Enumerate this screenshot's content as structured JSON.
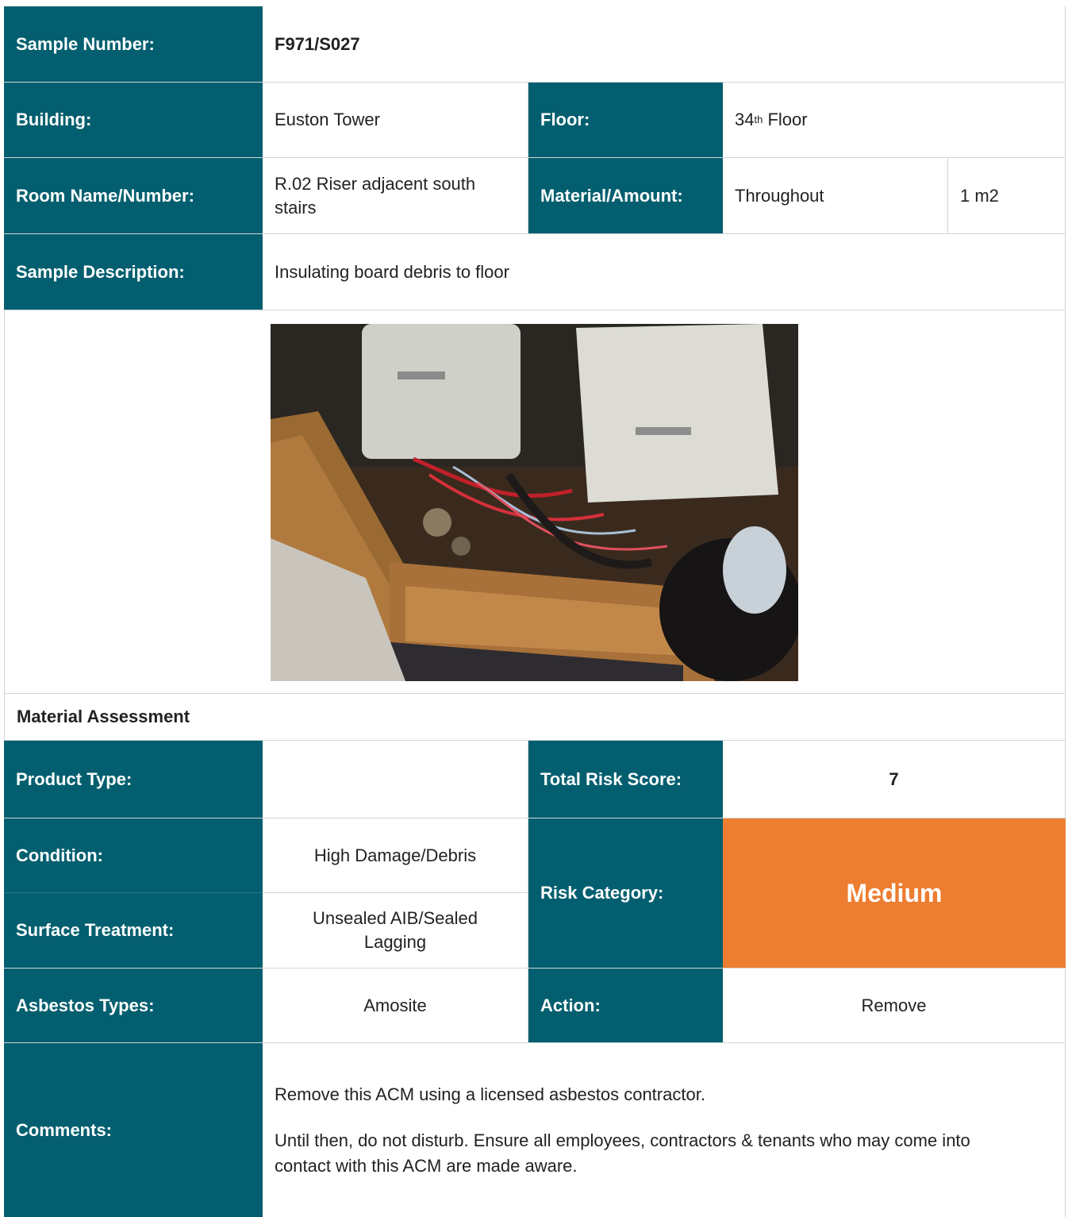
{
  "sample_number": {
    "label": "Sample Number:",
    "value": "F971/S027"
  },
  "building": {
    "label": "Building:",
    "value": "Euston Tower"
  },
  "floor": {
    "label": "Floor:",
    "value_num": "34",
    "value_sup": "th",
    "value_rest": " Floor"
  },
  "room": {
    "label": "Room Name/Number:",
    "value": "R.02 Riser adjacent south stairs"
  },
  "material_amount": {
    "label": "Material/Amount:",
    "material": "Throughout",
    "amount": "1 m2"
  },
  "sample_description": {
    "label": "Sample Description:",
    "value": "Insulating board debris to floor"
  },
  "material_assessment": {
    "heading": "Material Assessment"
  },
  "product_type": {
    "label": "Product Type:",
    "value": ""
  },
  "total_risk_score": {
    "label": "Total Risk Score:",
    "value": "7"
  },
  "condition": {
    "label": "Condition:",
    "value": "High Damage/Debris"
  },
  "surface_treatment": {
    "label": "Surface Treatment:",
    "value": "Unsealed AIB/Sealed Lagging"
  },
  "risk_category": {
    "label": "Risk Category:",
    "value": "Medium",
    "color": "#ed7d31"
  },
  "asbestos_types": {
    "label": "Asbestos Types:",
    "value": "Amosite"
  },
  "action": {
    "label": "Action:",
    "value": "Remove"
  },
  "comments": {
    "label": "Comments:",
    "line1": "Remove this ACM using a licensed asbestos contractor.",
    "line2": "Until then, do not disturb. Ensure all employees, contractors & tenants who may come into contact with this ACM are made aware."
  },
  "colors": {
    "header_bg": "#035f6f",
    "risk_medium": "#ed7d31"
  }
}
